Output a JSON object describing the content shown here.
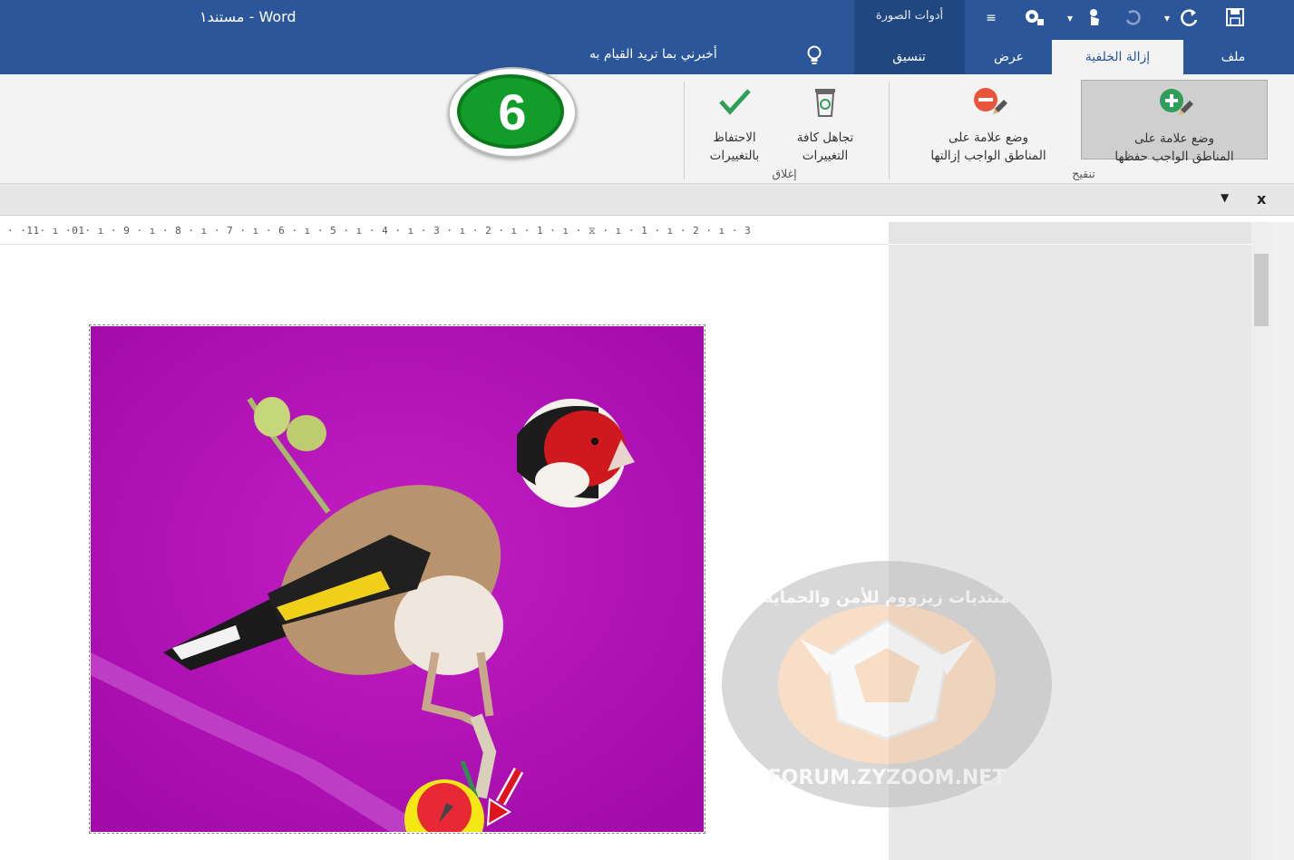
{
  "window": {
    "app_title": "Word - مستند١"
  },
  "qat": {
    "save_icon": "save-icon",
    "redo_icon": "redo-icon",
    "undo_icon": "undo-icon",
    "touch_icon": "touch-mode-icon",
    "picture_tools_icon": "picture-tools-icon",
    "customize_icon": "customize-qat-icon"
  },
  "context_tab_group": {
    "label": "أدوات الصورة"
  },
  "tabs": [
    {
      "label": "ملف"
    },
    {
      "label": "إزالة الخلفية"
    },
    {
      "label": "عرض"
    },
    {
      "label": "تنسيق"
    }
  ],
  "tell_me": {
    "text": "أخبرني بما تريد القيام به"
  },
  "ribbon": {
    "keep_button": {
      "line1": "وضع علامة على",
      "line2": "المناطق الواجب حفظها"
    },
    "remove_button": {
      "line1": "وضع علامة على",
      "line2": "المناطق الواجب إزالتها"
    },
    "discard_button": {
      "line1": "تجاهل كافة",
      "line2": "التغييرات"
    },
    "save_button": {
      "line1": "الاحتفاظ",
      "line2": "بالتغييرات"
    },
    "group_refine": "تنقيح",
    "group_close": "إغلاق"
  },
  "step_badge": {
    "number": "6"
  },
  "subbar": {
    "close_symbol": "x",
    "dropdown_symbol": "▼"
  },
  "ruler": {
    "text": "· ·11· ı ·01· ı · 9 · ı · 8 · ı · 7 · ı · 6 · ı · 5 · ı · 4 · ı · 3 · ı · 2 · ı · 1 · ı · ⧖ · ı · 1 · ı · 2 · ı · 3"
  },
  "colors": {
    "title_blue": "#2b579a",
    "context_blue": "#1f4780",
    "ribbon_bg": "#f3f3f3",
    "picture_magenta": "#b40fb9",
    "step_green": "#129c2a",
    "arrow_red": "#e0141e"
  },
  "watermark": {
    "text_top": "منتديات زيزووم للأمن والحماية",
    "text_bottom": "FORUM.ZYZOOM.NET"
  }
}
